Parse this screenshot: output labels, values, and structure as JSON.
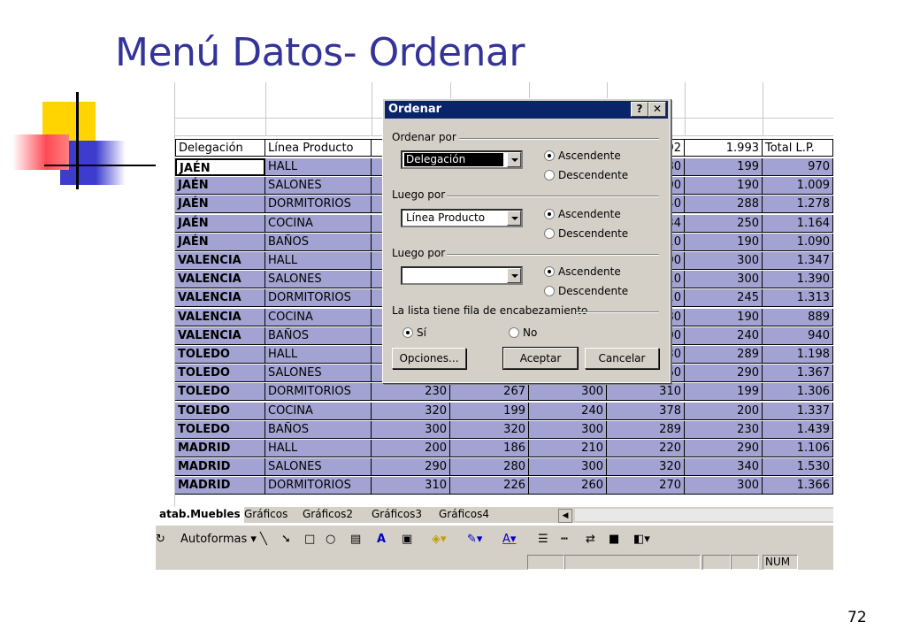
{
  "slide": {
    "title": "Menú Datos- Ordenar",
    "page_number": "72"
  },
  "sheet": {
    "header_row": [
      "Delegación",
      "Línea Producto",
      "",
      "",
      "",
      "92",
      "1.993",
      "Total L.P."
    ],
    "rows": [
      {
        "del": "JAÉN",
        "prod": "HALL",
        "c5": "80",
        "c6": "199",
        "tot": "970"
      },
      {
        "del": "JAÉN",
        "prod": "SALONES",
        "c5": "00",
        "c6": "190",
        "tot": "1.009"
      },
      {
        "del": "JAÉN",
        "prod": "DORMITORIOS",
        "c5": "40",
        "c6": "288",
        "tot": "1.278"
      },
      {
        "del": "JAÉN",
        "prod": "COCINA",
        "c5": "34",
        "c6": "250",
        "tot": "1.164"
      },
      {
        "del": "JAÉN",
        "prod": "BAÑOS",
        "c5": "10",
        "c6": "190",
        "tot": "1.090"
      },
      {
        "del": "VALENCIA",
        "prod": "HALL",
        "c5": "90",
        "c6": "300",
        "tot": "1.347"
      },
      {
        "del": "VALENCIA",
        "prod": "SALONES",
        "c5": "10",
        "c6": "300",
        "tot": "1.390"
      },
      {
        "del": "VALENCIA",
        "prod": "DORMITORIOS",
        "c5": "10",
        "c6": "245",
        "tot": "1.313"
      },
      {
        "del": "VALENCIA",
        "prod": "COCINA",
        "c5": "80",
        "c6": "190",
        "tot": "889"
      },
      {
        "del": "VALENCIA",
        "prod": "BAÑOS",
        "c5": "00",
        "c6": "240",
        "tot": "940"
      },
      {
        "del": "TOLEDO",
        "prod": "HALL",
        "c5": "30",
        "c6": "289",
        "tot": "1.198"
      },
      {
        "del": "TOLEDO",
        "prod": "SALONES",
        "c5": "60",
        "c6": "290",
        "tot": "1.367"
      }
    ],
    "full_rows": [
      {
        "del": "TOLEDO",
        "prod": "DORMITORIOS",
        "v": [
          "230",
          "267",
          "300",
          "310",
          "199",
          "1.306"
        ]
      },
      {
        "del": "TOLEDO",
        "prod": "COCINA",
        "v": [
          "320",
          "199",
          "240",
          "378",
          "200",
          "1.337"
        ]
      },
      {
        "del": "TOLEDO",
        "prod": "BAÑOS",
        "v": [
          "300",
          "320",
          "300",
          "289",
          "230",
          "1.439"
        ]
      },
      {
        "del": "MADRID",
        "prod": "HALL",
        "v": [
          "200",
          "186",
          "210",
          "220",
          "290",
          "1.106"
        ]
      },
      {
        "del": "MADRID",
        "prod": "SALONES",
        "v": [
          "290",
          "280",
          "300",
          "320",
          "340",
          "1.530"
        ]
      },
      {
        "del": "MADRID",
        "prod": "DORMITORIOS",
        "v": [
          "310",
          "226",
          "260",
          "270",
          "300",
          "1.366"
        ]
      }
    ],
    "tabs": [
      "atab.Muebles",
      "Gráficos",
      "Gráficos2",
      "Gráficos3",
      "Gráficos4"
    ],
    "drawing_toolbar": {
      "autoshapes": "Autoformas"
    },
    "status": {
      "num": "NUM"
    }
  },
  "dialog": {
    "title": "Ordenar",
    "help_btn": "?",
    "close_btn": "✕",
    "sort_by": {
      "label": "Ordenar por",
      "value": "Delegación",
      "asc": "Ascendente",
      "desc": "Descendente",
      "selected": "asc"
    },
    "then_by_1": {
      "label": "Luego por",
      "value": "Línea Producto",
      "asc": "Ascendente",
      "desc": "Descendente",
      "selected": "asc"
    },
    "then_by_2": {
      "label": "Luego por",
      "value": "",
      "asc": "Ascendente",
      "desc": "Descendente",
      "selected": "asc"
    },
    "header_row": {
      "label": "La lista tiene fila de encabezamiento",
      "yes": "Sí",
      "no": "No",
      "selected": "yes"
    },
    "buttons": {
      "options": "Opciones...",
      "ok": "Aceptar",
      "cancel": "Cancelar"
    }
  },
  "colors": {
    "title": "#33339a",
    "selection": "#a3a3d3",
    "titlebar": "#0a246a",
    "dialog_bg": "#d4d0c8"
  }
}
